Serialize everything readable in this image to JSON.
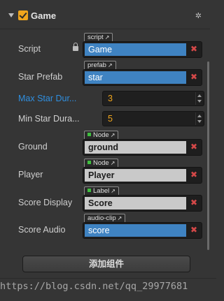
{
  "component": {
    "title": "Game",
    "enabled": true,
    "settings_icon": "gear-icon"
  },
  "properties": [
    {
      "label": "Script",
      "type_tag": "script",
      "value": "Game",
      "style": "blue",
      "locked": true
    },
    {
      "label": "Star Prefab",
      "type_tag": "prefab",
      "value": "star",
      "style": "blue"
    },
    {
      "label": "Max Star Dur...",
      "value": "3",
      "highlighted": true
    },
    {
      "label": "Min Star Dura...",
      "value": "5"
    },
    {
      "label": "Ground",
      "type_tag": "Node",
      "value": "ground",
      "style": "gray"
    },
    {
      "label": "Player",
      "type_tag": "Node",
      "value": "Player",
      "style": "gray"
    },
    {
      "label": "Score Display",
      "type_tag": "Label",
      "value": "Score",
      "style": "gray"
    },
    {
      "label": "Score Audio",
      "type_tag": "audio-clip",
      "value": "score",
      "style": "blue"
    }
  ],
  "remove_glyph": "✖",
  "add_component_button": "添加组件",
  "watermark": "https://blog.csdn.net/qq_29977681"
}
